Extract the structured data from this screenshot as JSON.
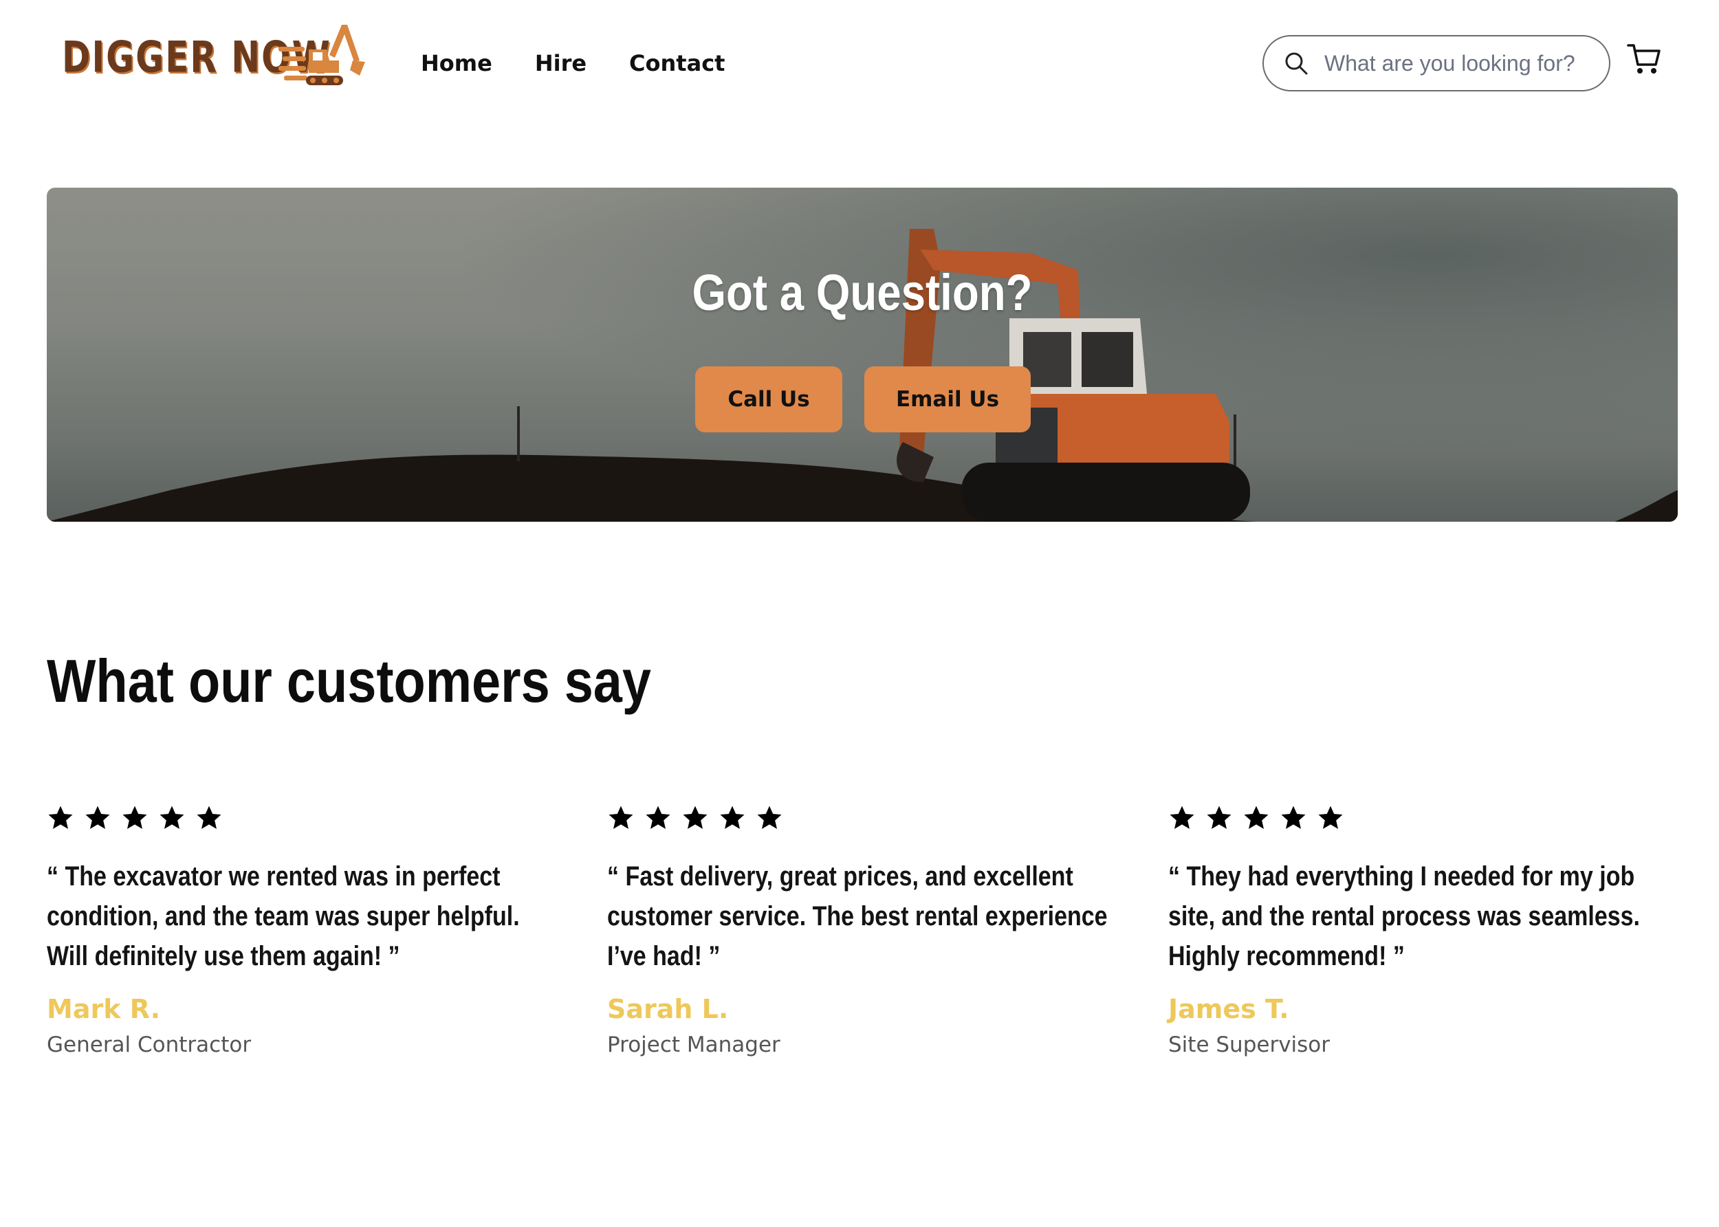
{
  "brand": {
    "logo_text": "DIGGER NOW",
    "primary_color": "#e0894a",
    "accent_color": "#eec85a"
  },
  "nav": {
    "items": [
      {
        "label": "Home"
      },
      {
        "label": "Hire"
      },
      {
        "label": "Contact"
      }
    ]
  },
  "search": {
    "placeholder": "What are you looking for?",
    "value": ""
  },
  "header_icons": {
    "search": "search-icon",
    "cart": "cart-icon"
  },
  "hero": {
    "title": "Got a Question?",
    "call_label": "Call Us",
    "email_label": "Email Us"
  },
  "testimonials": {
    "title": "What our customers say",
    "items": [
      {
        "rating": 5,
        "quote": "“ The excavator we rented was in perfect condition, and the team was super helpful. Will definitely use them again! ”",
        "name": "Mark R.",
        "role": "General Contractor"
      },
      {
        "rating": 5,
        "quote": "“ Fast delivery, great prices, and excellent customer service. The best rental experience I’ve had! ”",
        "name": "Sarah L.",
        "role": "Project Manager"
      },
      {
        "rating": 5,
        "quote": "“ They had everything I needed for my job site, and the rental process was seamless. Highly recommend! ”",
        "name": "James T.",
        "role": "Site Supervisor"
      }
    ]
  }
}
